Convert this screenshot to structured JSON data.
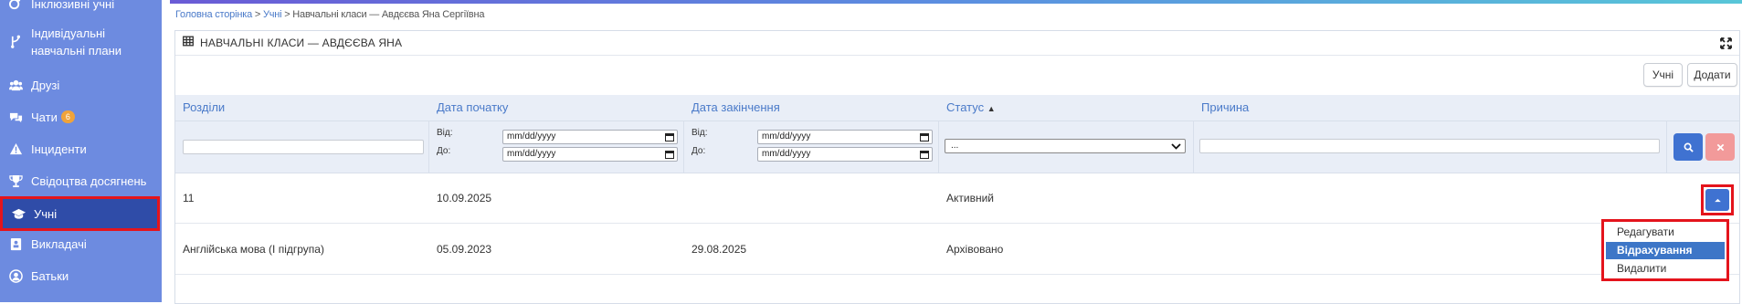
{
  "sidebar": {
    "items": [
      {
        "label": "Інклюзивні учні",
        "icon": "inclusive-icon"
      },
      {
        "label": "Індивідуальні навчальні плани",
        "icon": "branch-icon"
      },
      {
        "label": "Друзі",
        "icon": "friends-icon"
      },
      {
        "label": "Чати",
        "icon": "chat-icon",
        "badge": "6"
      },
      {
        "label": "Інциденти",
        "icon": "warning-icon"
      },
      {
        "label": "Свідоцтва досягнень",
        "icon": "trophy-icon"
      },
      {
        "label": "Учні",
        "icon": "graduation-cap-icon",
        "active": true
      },
      {
        "label": "Викладачі",
        "icon": "teacher-icon"
      },
      {
        "label": "Батьки",
        "icon": "user-circle-icon"
      }
    ]
  },
  "breadcrumb": {
    "home": "Головна сторінка",
    "sep1": " > ",
    "students": "Учні",
    "current": " > Навчальні класи — Авдєєва Яна Сергіївна"
  },
  "panel": {
    "title": "НАВЧАЛЬНІ КЛАСИ — АВДЄЄВА ЯНА",
    "btn_students": "Учні",
    "btn_add": "Додати"
  },
  "table": {
    "columns": [
      "Розділи",
      "Дата початку",
      "Дата закінчення",
      "Статус",
      "Причина"
    ],
    "sort_indicator": "▲",
    "filters": {
      "from_label": "Від:",
      "to_label": "До:",
      "date_placeholder": "mm/dd/yyyy",
      "status_selected": "..."
    },
    "rows": [
      {
        "section": "11",
        "start": "10.09.2025",
        "end": "",
        "status": "Активний",
        "reason": ""
      },
      {
        "section": "Англійська мова (I підгрупа)",
        "start": "05.09.2023",
        "end": "29.08.2025",
        "status": "Архівовано",
        "reason": ""
      }
    ]
  },
  "dropdown": {
    "items": [
      "Редагувати",
      "Відрахування",
      "Видалити"
    ],
    "highlighted": "Відрахування"
  },
  "colors": {
    "sidebar": "#6d8be0",
    "sidebar_active": "#2f4ca8",
    "accent": "#3f72d1",
    "highlight_red": "#e4141c",
    "badge": "#f0a33a"
  }
}
